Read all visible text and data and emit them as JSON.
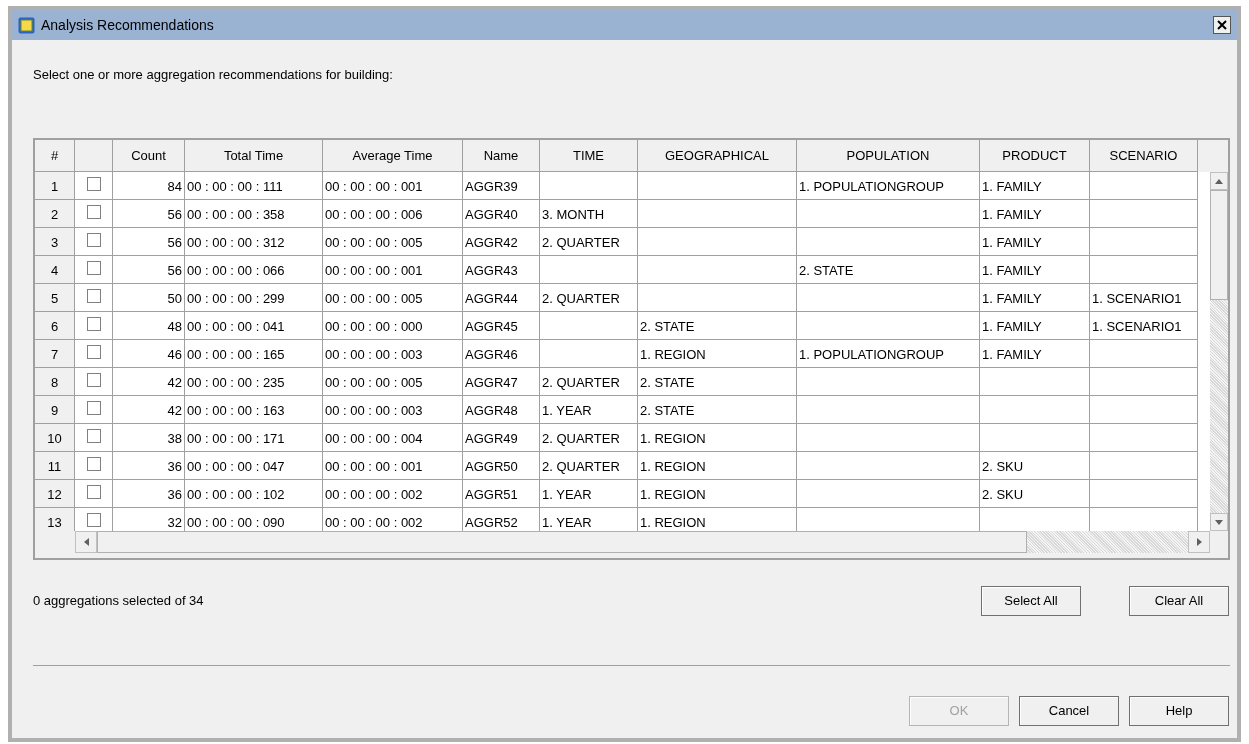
{
  "window": {
    "title": "Analysis Recommendations"
  },
  "instruction": "Select one or more aggregation recommendations for building:",
  "table": {
    "index_header": "#",
    "columns": [
      "Count",
      "Total Time",
      "Average Time",
      "Name",
      "TIME",
      "GEOGRAPHICAL",
      "POPULATION",
      "PRODUCT",
      "SCENARIO"
    ],
    "rows": [
      {
        "index": "1",
        "checked": false,
        "cells": [
          "84",
          "00 : 00 : 00 : 111",
          "00 : 00 : 00 : 001",
          "AGGR39",
          null,
          null,
          "1. POPULATIONGROUP",
          "1. FAMILY",
          null
        ]
      },
      {
        "index": "2",
        "checked": false,
        "cells": [
          "56",
          "00 : 00 : 00 : 358",
          "00 : 00 : 00 : 006",
          "AGGR40",
          "3. MONTH",
          null,
          null,
          "1. FAMILY",
          null
        ]
      },
      {
        "index": "3",
        "checked": false,
        "cells": [
          "56",
          "00 : 00 : 00 : 312",
          "00 : 00 : 00 : 005",
          "AGGR42",
          "2. QUARTER",
          null,
          null,
          "1. FAMILY",
          null
        ]
      },
      {
        "index": "4",
        "checked": false,
        "cells": [
          "56",
          "00 : 00 : 00 : 066",
          "00 : 00 : 00 : 001",
          "AGGR43",
          null,
          null,
          "2. STATE",
          "1. FAMILY",
          null
        ]
      },
      {
        "index": "5",
        "checked": false,
        "cells": [
          "50",
          "00 : 00 : 00 : 299",
          "00 : 00 : 00 : 005",
          "AGGR44",
          "2. QUARTER",
          null,
          null,
          "1. FAMILY",
          "1. SCENARIO1"
        ]
      },
      {
        "index": "6",
        "checked": false,
        "cells": [
          "48",
          "00 : 00 : 00 : 041",
          "00 : 00 : 00 : 000",
          "AGGR45",
          null,
          "2. STATE",
          null,
          "1. FAMILY",
          "1. SCENARIO1"
        ]
      },
      {
        "index": "7",
        "checked": false,
        "cells": [
          "46",
          "00 : 00 : 00 : 165",
          "00 : 00 : 00 : 003",
          "AGGR46",
          null,
          "1. REGION",
          "1. POPULATIONGROUP",
          "1. FAMILY",
          null
        ]
      },
      {
        "index": "8",
        "checked": false,
        "cells": [
          "42",
          "00 : 00 : 00 : 235",
          "00 : 00 : 00 : 005",
          "AGGR47",
          "2. QUARTER",
          "2. STATE",
          null,
          null,
          null
        ]
      },
      {
        "index": "9",
        "checked": false,
        "cells": [
          "42",
          "00 : 00 : 00 : 163",
          "00 : 00 : 00 : 003",
          "AGGR48",
          "1. YEAR",
          "2. STATE",
          null,
          null,
          null
        ]
      },
      {
        "index": "10",
        "checked": false,
        "cells": [
          "38",
          "00 : 00 : 00 : 171",
          "00 : 00 : 00 : 004",
          "AGGR49",
          "2. QUARTER",
          "1. REGION",
          null,
          null,
          null
        ]
      },
      {
        "index": "11",
        "checked": false,
        "cells": [
          "36",
          "00 : 00 : 00 : 047",
          "00 : 00 : 00 : 001",
          "AGGR50",
          "2. QUARTER",
          "1. REGION",
          null,
          "2. SKU",
          null
        ]
      },
      {
        "index": "12",
        "checked": false,
        "cells": [
          "36",
          "00 : 00 : 00 : 102",
          "00 : 00 : 00 : 002",
          "AGGR51",
          "1. YEAR",
          "1. REGION",
          null,
          "2. SKU",
          null
        ]
      },
      {
        "index": "13",
        "checked": false,
        "cells": [
          "32",
          "00 : 00 : 00 : 090",
          "00 : 00 : 00 : 002",
          "AGGR52",
          "1. YEAR",
          "1. REGION",
          null,
          null,
          null
        ]
      }
    ]
  },
  "status": "0 aggregations selected of 34",
  "selection_buttons": [
    {
      "label": "Select All"
    },
    {
      "label": "Clear All"
    }
  ],
  "dialog_buttons": [
    {
      "label": "OK",
      "disabled": true
    },
    {
      "label": "Cancel",
      "disabled": false
    },
    {
      "label": "Help",
      "disabled": false
    }
  ]
}
